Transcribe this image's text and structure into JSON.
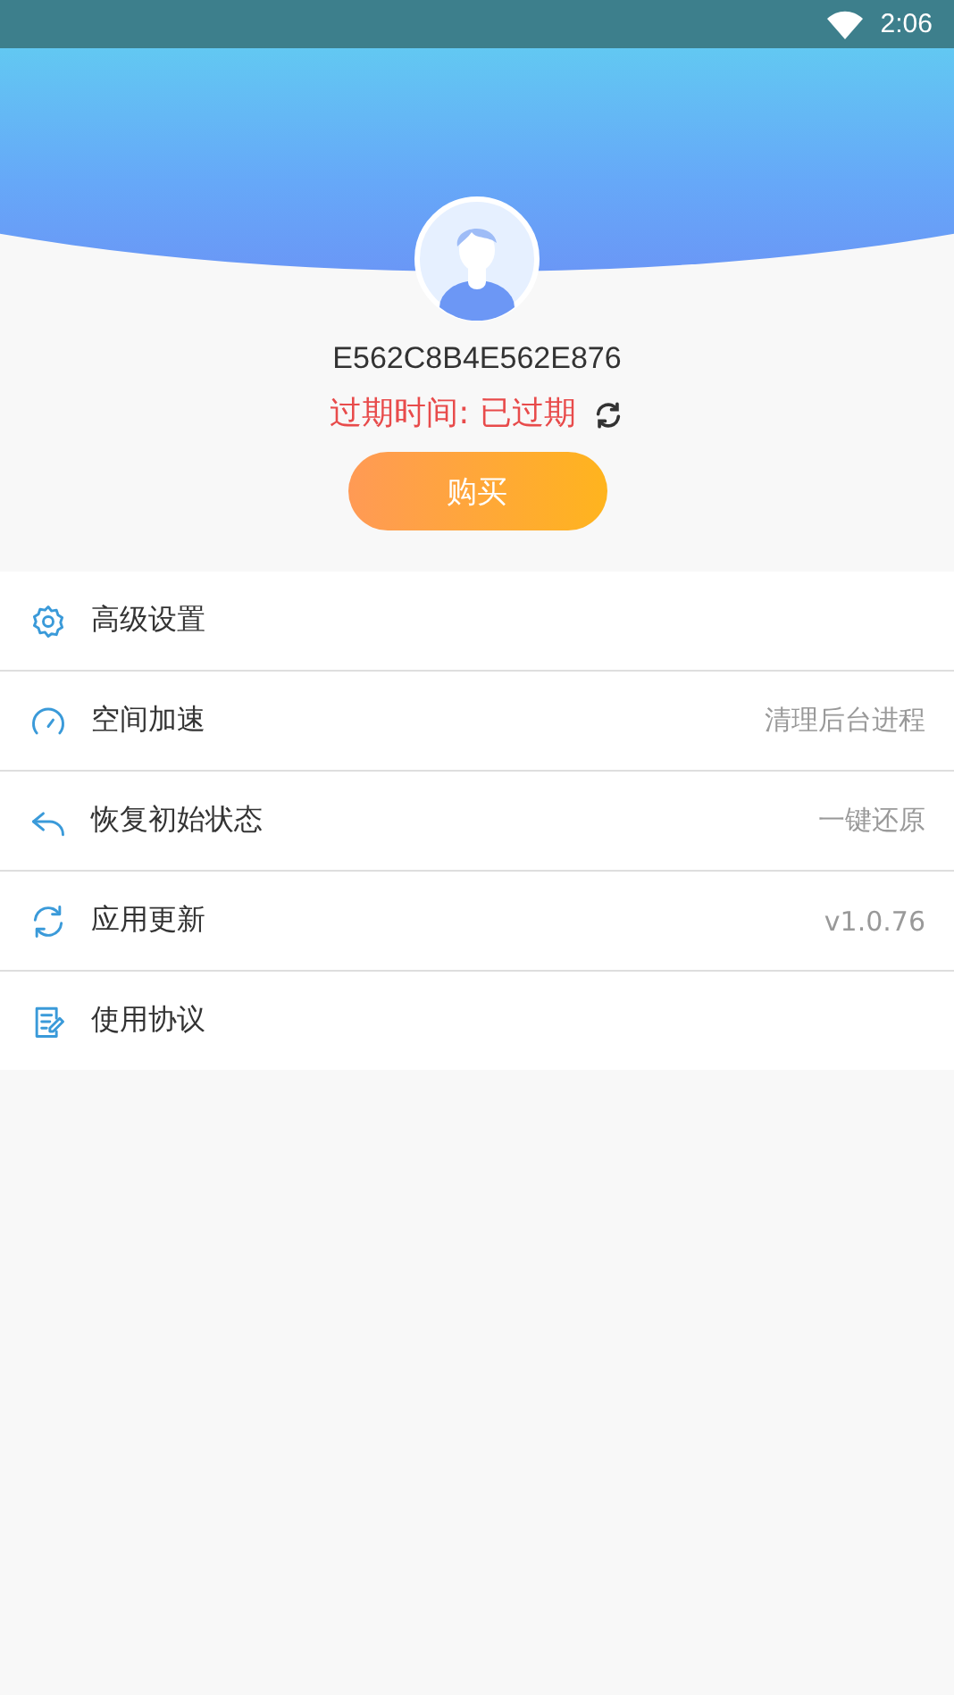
{
  "status_bar": {
    "time": "2:06"
  },
  "profile": {
    "device_id": "E562C8B4E562E876",
    "expiry": "过期时间: 已过期",
    "buy_button": "购买"
  },
  "menu": [
    {
      "kind": "settings",
      "label": "高级设置"
    },
    {
      "kind": "speed",
      "label": "空间加速",
      "detail": "清理后台进程"
    },
    {
      "kind": "restore",
      "label": "恢复初始状态",
      "detail": "一键还原"
    },
    {
      "kind": "update",
      "label": "应用更新",
      "detail": "v1.0.76"
    },
    {
      "kind": "agreement",
      "label": "使用协议"
    }
  ]
}
